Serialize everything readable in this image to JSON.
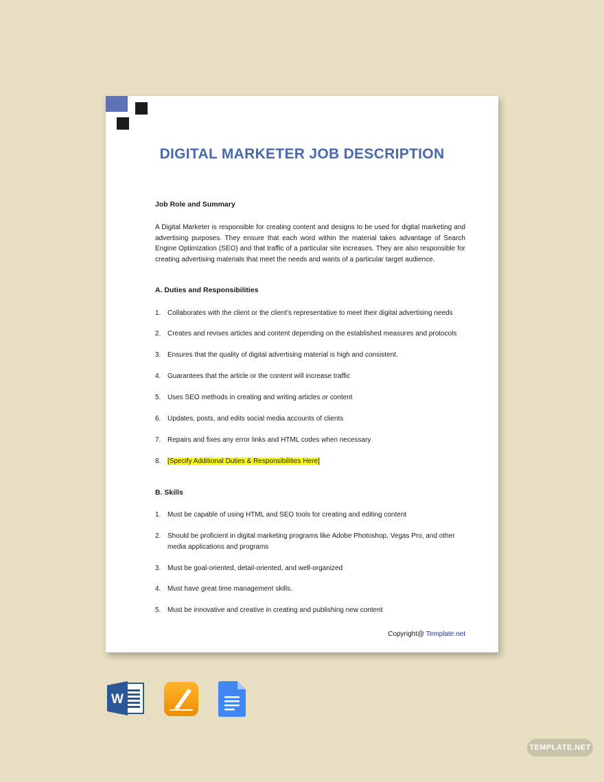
{
  "document": {
    "title": "DIGITAL MARKETER JOB DESCRIPTION",
    "role_heading": "Job Role and Summary",
    "summary": "A Digital Marketer is responsible for creating content and designs to be used for digital marketing and advertising purposes. They ensure that each word within the material takes advantage of Search Engine Optimization (SEO) and that traffic of a particular site increases. They are also responsible for creating advertising materials that meet the needs and wants of a particular target audience.",
    "duties_heading": "A. Duties and Responsibilities",
    "duties": [
      {
        "num": "1.",
        "text": "Collaborates with the client or the client’s representative to meet their digital advertising needs"
      },
      {
        "num": "2.",
        "text": "Creates and revises articles and content depending on the established measures and protocols"
      },
      {
        "num": "3.",
        "text": "Ensures that the quality of digital advertising material is high and consistent."
      },
      {
        "num": "4.",
        "text": "Guarantees that the article or the content will increase traffic"
      },
      {
        "num": "5.",
        "text": "Uses SEO methods in creating and writing articles or content"
      },
      {
        "num": "6.",
        "text": "Updates, posts, and edits social media accounts of clients"
      },
      {
        "num": "7.",
        "text": "Repairs and fixes any error links and HTML codes when necessary"
      },
      {
        "num": "8.",
        "text": "[Specify Additional Duties & Responsibilities Here]"
      }
    ],
    "skills_heading": "B. Skills",
    "skills": [
      {
        "num": "1.",
        "text": "Must be capable of using HTML and SEO tools for creating and editing content"
      },
      {
        "num": "2.",
        "text": "Should be proficient in digital marketing programs like Adobe Photoshop, Vegas Pro, and other media applications and programs"
      },
      {
        "num": "3.",
        "text": "Must be goal-oriented, detail-oriented, and well-organized"
      },
      {
        "num": "4.",
        "text": "Must have great time management skills."
      },
      {
        "num": "5.",
        "text": "Must be innovative and creative in creating and publishing new content"
      }
    ],
    "copyright_prefix": "Copyright@ ",
    "copyright_link": "Template.net"
  },
  "apps": [
    {
      "icon": "word-icon",
      "letter": "W",
      "color": "#2b5797"
    },
    {
      "icon": "pages-icon",
      "color": "#f39c12"
    },
    {
      "icon": "google-docs-icon",
      "color": "#4285f4"
    }
  ],
  "watermark": "TEMPLATE.NET",
  "colors": {
    "background": "#e8dfc2",
    "accent": "#4a69ad",
    "highlight": "#ffff00"
  }
}
